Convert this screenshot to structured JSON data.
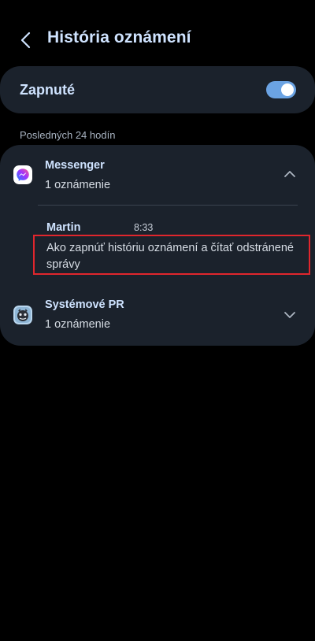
{
  "header": {
    "title": "História oznámení"
  },
  "toggle": {
    "label": "Zapnuté",
    "state": "on",
    "color": "#6ba3e3"
  },
  "section": {
    "label": "Posledných 24 hodín"
  },
  "apps": [
    {
      "name": "Messenger",
      "count": "1 oznámenie",
      "icon": "messenger-icon",
      "expanded": true,
      "notifications": [
        {
          "sender": "Martin",
          "time": "8:33",
          "text": "Ako zapnúť históriu oznámení a čítať odstránené správy"
        }
      ]
    },
    {
      "name": "Systémové PR",
      "count": "1 oznámenie",
      "icon": "system-pr-icon",
      "expanded": false
    }
  ],
  "colors": {
    "background": "#000000",
    "card": "#1b222c",
    "accent_text": "#cfe3ff",
    "highlight": "#e0262d"
  }
}
